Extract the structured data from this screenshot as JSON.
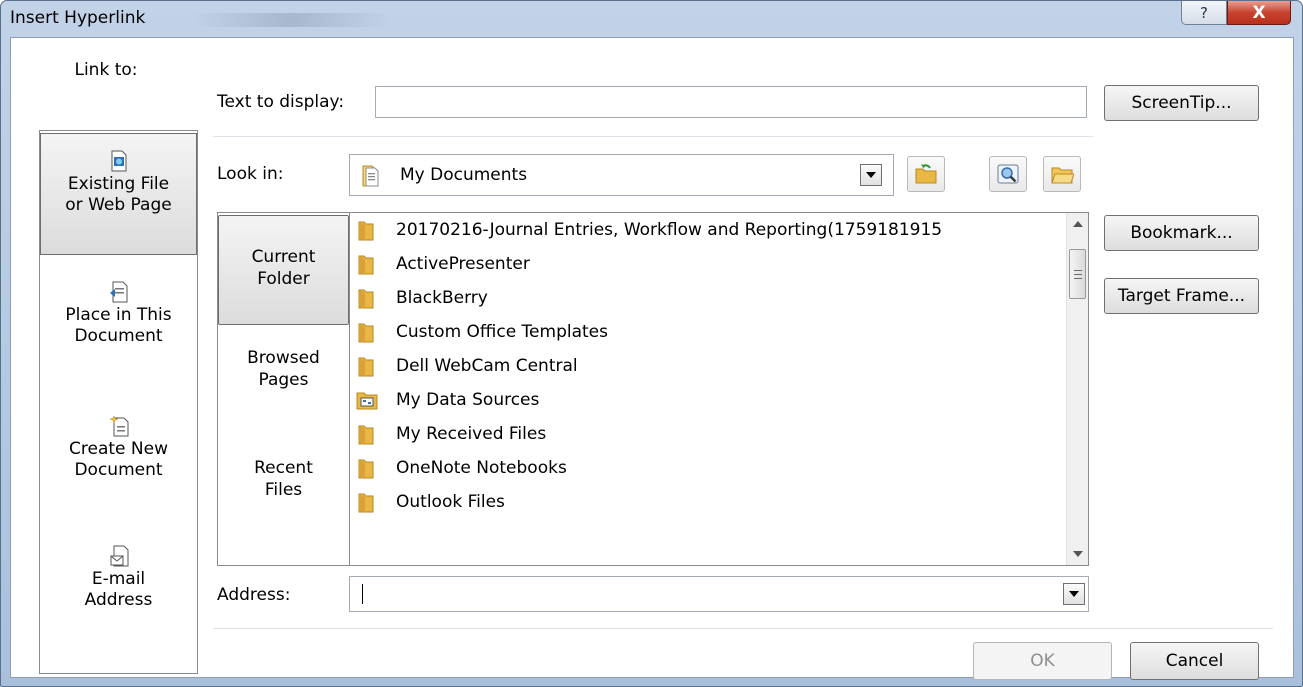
{
  "window": {
    "title": "Insert Hyperlink",
    "help_label": "?",
    "close_label": "X"
  },
  "left_panel": {
    "header": "Link to:",
    "items": [
      {
        "line1": "Existing File",
        "line2": "or Web Page",
        "icon": "existing-file-icon",
        "selected": true
      },
      {
        "line1": "Place in This",
        "line2": "Document",
        "icon": "place-in-document-icon",
        "selected": false
      },
      {
        "line1": "Create New",
        "line2": "Document",
        "icon": "create-new-document-icon",
        "selected": false
      },
      {
        "line1": "E-mail",
        "line2": "Address",
        "icon": "email-address-icon",
        "selected": false
      }
    ]
  },
  "text_to_display": {
    "label": "Text to display:",
    "value": ""
  },
  "buttons": {
    "screentip": "ScreenTip...",
    "bookmark": "Bookmark...",
    "target_frame": "Target Frame...",
    "ok": "OK",
    "cancel": "Cancel"
  },
  "look_in": {
    "label": "Look in:",
    "value": "My Documents"
  },
  "tabs": [
    {
      "line1": "Current",
      "line2": "Folder",
      "selected": true
    },
    {
      "line1": "Browsed",
      "line2": "Pages",
      "selected": false
    },
    {
      "line1": "Recent",
      "line2": "Files",
      "selected": false
    }
  ],
  "files": [
    {
      "name": "20170216-Journal Entries, Workflow and Reporting(1759181915",
      "icon": "folder-icon"
    },
    {
      "name": "ActivePresenter",
      "icon": "folder-icon"
    },
    {
      "name": "BlackBerry",
      "icon": "folder-icon"
    },
    {
      "name": "Custom Office Templates",
      "icon": "folder-icon"
    },
    {
      "name": "Dell WebCam Central",
      "icon": "folder-icon"
    },
    {
      "name": "My Data Sources",
      "icon": "data-sources-folder-icon"
    },
    {
      "name": "My Received Files",
      "icon": "folder-icon"
    },
    {
      "name": "OneNote Notebooks",
      "icon": "folder-icon"
    },
    {
      "name": "Outlook Files",
      "icon": "folder-icon"
    }
  ],
  "address": {
    "label": "Address:",
    "value": ""
  },
  "colors": {
    "title_bar": "#b9cbe3",
    "close_button": "#c7442f",
    "folder": "#e8b746"
  }
}
